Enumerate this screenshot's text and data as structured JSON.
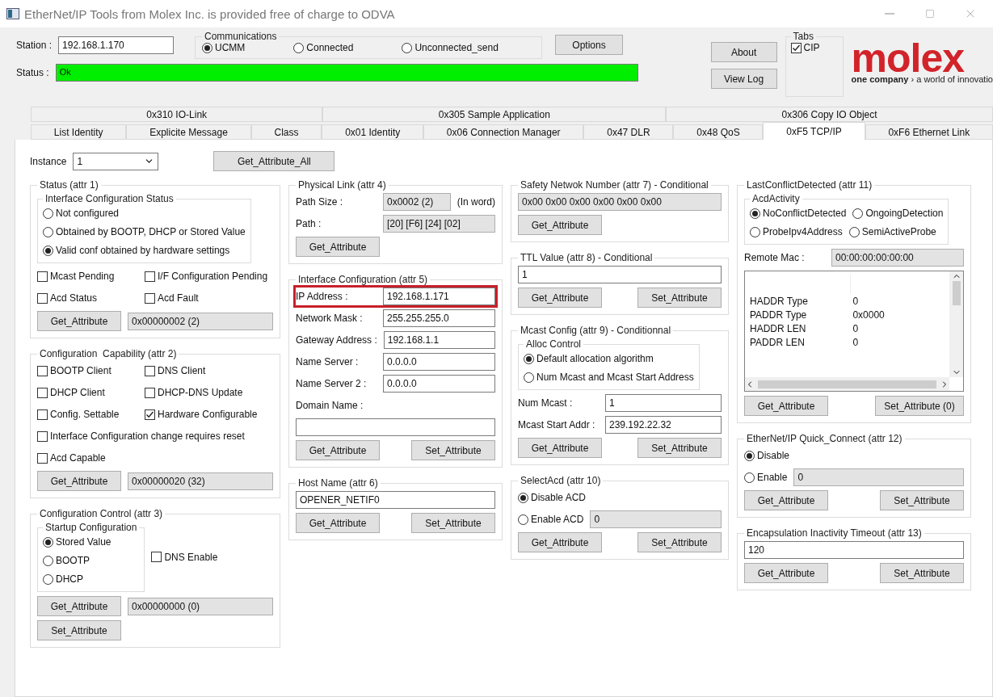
{
  "window": {
    "title": "EtherNet/IP Tools from Molex Inc. is provided free of charge to ODVA"
  },
  "header": {
    "station_label": "Station :",
    "station_value": "192.168.1.170",
    "communications": {
      "title": "Communications",
      "options": [
        {
          "label": "UCMM",
          "selected": true
        },
        {
          "label": "Connected",
          "selected": false
        },
        {
          "label": "Unconnected_send",
          "selected": false
        }
      ]
    },
    "options_button": "Options",
    "about_button": "About",
    "view_log_button": "View Log",
    "tabs_group": {
      "title": "Tabs",
      "options": [
        {
          "label": "CIP",
          "checked": true
        }
      ]
    },
    "logo": {
      "wordmark": "molex",
      "tagline": "**one company** › a world of innovatio"
    },
    "status": {
      "label": "Status :",
      "value": "Ok",
      "ok": true
    }
  },
  "tab_rows": [
    [
      {
        "label": "0x310 IO-Link",
        "selected": false
      },
      {
        "label": "0x305 Sample Application",
        "selected": false
      },
      {
        "label": "0x306 Copy IO Object",
        "selected": false
      }
    ],
    [
      {
        "label": "List Identity",
        "selected": false
      },
      {
        "label": "Explicite Message",
        "selected": false
      },
      {
        "label": "Class",
        "selected": false
      },
      {
        "label": "0x01 Identity",
        "selected": false
      },
      {
        "label": "0x06 Connection Manager",
        "selected": false
      },
      {
        "label": "0x47 DLR",
        "selected": false
      },
      {
        "label": "0x48 QoS",
        "selected": false
      },
      {
        "label": "0xF5 TCP/IP",
        "selected": true
      },
      {
        "label": "0xF6 Ethernet Link",
        "selected": false
      }
    ]
  ],
  "tab_page": {
    "instance": {
      "label": "Instance",
      "value": "1"
    },
    "get_all_button": "Get_Attribute_All",
    "columns": [
      [
        {
          "title": "Status (attr 1)",
          "rows": [
            [
              {
                "kind": "subgroup",
                "title": "Interface Configuration Status",
                "rows": [
                  [
                    {
                      "kind": "radio",
                      "label": "Not configured",
                      "selected": false
                    }
                  ],
                  [
                    {
                      "kind": "radio",
                      "label": "Obtained by BOOTP, DHCP or Stored Value",
                      "selected": false
                    }
                  ],
                  [
                    {
                      "kind": "radio",
                      "label": "Valid conf obtained by hardware settings",
                      "selected": true
                    }
                  ]
                ]
              }
            ],
            [
              {
                "kind": "checkbox",
                "label": "Mcast Pending",
                "checked": false
              },
              {
                "kind": "checkbox",
                "label": "I/F Configuration Pending",
                "checked": false
              }
            ],
            [
              {
                "kind": "checkbox",
                "label": "Acd Status",
                "checked": false
              },
              {
                "kind": "checkbox",
                "label": "Acd Fault",
                "checked": false
              }
            ],
            [
              {
                "kind": "button",
                "label": "Get_Attribute"
              },
              {
                "kind": "field",
                "value": "0x00000002 (2)",
                "readonly": true,
                "highlighted": false
              }
            ]
          ]
        },
        {
          "title": "Configuration  Capability (attr 2)",
          "rows": [
            [
              {
                "kind": "checkbox",
                "label": "BOOTP Client",
                "checked": false
              },
              {
                "kind": "checkbox",
                "label": "DNS Client",
                "checked": false
              }
            ],
            [
              {
                "kind": "checkbox",
                "label": "DHCP Client",
                "checked": false
              },
              {
                "kind": "checkbox",
                "label": "DHCP-DNS Update",
                "checked": false
              }
            ],
            [
              {
                "kind": "checkbox",
                "label": "Config. Settable",
                "checked": false
              },
              {
                "kind": "checkbox",
                "label": "Hardware Configurable",
                "checked": true
              }
            ],
            [
              {
                "kind": "checkbox",
                "label": "Interface Configuration change requires reset",
                "checked": false
              }
            ],
            [
              {
                "kind": "checkbox",
                "label": "Acd Capable",
                "checked": false
              }
            ],
            [
              {
                "kind": "button",
                "label": "Get_Attribute"
              },
              {
                "kind": "field",
                "value": "0x00000020 (32)",
                "readonly": true,
                "highlighted": false
              }
            ]
          ]
        },
        {
          "title": "Configuration Control (attr 3)",
          "rows": [
            [
              {
                "kind": "subgroup",
                "title": "Startup Configuration",
                "rows": [
                  [
                    {
                      "kind": "radio",
                      "label": "Stored Value",
                      "selected": true
                    }
                  ],
                  [
                    {
                      "kind": "radio",
                      "label": "BOOTP",
                      "selected": false
                    }
                  ],
                  [
                    {
                      "kind": "radio",
                      "label": "DHCP",
                      "selected": false
                    }
                  ]
                ]
              },
              {
                "kind": "checkbox",
                "label": "DNS Enable",
                "checked": false
              }
            ],
            [
              {
                "kind": "button",
                "label": "Get_Attribute"
              },
              {
                "kind": "field",
                "value": "0x00000000 (0)",
                "readonly": true,
                "highlighted": false
              }
            ],
            [
              {
                "kind": "button",
                "label": "Set_Attribute"
              }
            ]
          ]
        }
      ],
      [
        {
          "title": "Physical Link (attr 4)",
          "rows": [
            [
              {
                "kind": "field",
                "label": "Path Size :",
                "value": "0x0002 (2)",
                "readonly": true,
                "highlighted": false
              },
              {
                "kind": "text",
                "label": "(In word)"
              }
            ],
            [
              {
                "kind": "field",
                "label": "Path :",
                "value": "[20] [F6] [24] [02]",
                "readonly": true,
                "highlighted": false
              }
            ],
            [
              {
                "kind": "button",
                "label": "Get_Attribute"
              }
            ]
          ]
        },
        {
          "title": "Interface Configuration (attr 5)",
          "rows": [
            [
              {
                "kind": "field",
                "label": "IP Address :",
                "value": "192.168.1.171",
                "readonly": false,
                "highlighted": true
              }
            ],
            [
              {
                "kind": "field",
                "label": "Network Mask :",
                "value": "255.255.255.0",
                "readonly": false,
                "highlighted": false
              }
            ],
            [
              {
                "kind": "field",
                "label": "Gateway Address :",
                "value": "192.168.1.1",
                "readonly": false,
                "highlighted": false
              }
            ],
            [
              {
                "kind": "field",
                "label": "Name Server :",
                "value": "0.0.0.0",
                "readonly": false,
                "highlighted": false
              }
            ],
            [
              {
                "kind": "field",
                "label": "Name Server 2 :",
                "value": "0.0.0.0",
                "readonly": false,
                "highlighted": false
              }
            ],
            [
              {
                "kind": "text",
                "label": "Domain Name :"
              }
            ],
            [
              {
                "kind": "field",
                "readonly": false,
                "highlighted": false
              }
            ],
            [
              {
                "kind": "button",
                "label": "Get_Attribute"
              },
              {
                "kind": "button",
                "label": "Set_Attribute"
              }
            ]
          ]
        },
        {
          "title": "Host Name (attr 6)",
          "rows": [
            [
              {
                "kind": "field",
                "value": "OPENER_NETIF0",
                "readonly": false,
                "highlighted": false
              }
            ],
            [
              {
                "kind": "button",
                "label": "Get_Attribute"
              },
              {
                "kind": "button",
                "label": "Set_Attribute"
              }
            ]
          ]
        }
      ],
      [
        {
          "title": "Safety Netwok Number (attr 7) - Conditional",
          "rows": [
            [
              {
                "kind": "field",
                "value": "0x00 0x00 0x00 0x00 0x00 0x00",
                "readonly": true,
                "highlighted": false
              }
            ],
            [
              {
                "kind": "button",
                "label": "Get_Attribute"
              }
            ]
          ]
        },
        {
          "title": "TTL Value (attr 8) - Conditional",
          "rows": [
            [
              {
                "kind": "field",
                "value": "1",
                "readonly": false,
                "highlighted": false
              }
            ],
            [
              {
                "kind": "button",
                "label": "Get_Attribute"
              },
              {
                "kind": "button",
                "label": "Set_Attribute"
              }
            ]
          ]
        },
        {
          "title": "Mcast Config (attr 9) - Conditionnal",
          "rows": [
            [
              {
                "kind": "subgroup",
                "title": "Alloc Control",
                "rows": [
                  [
                    {
                      "kind": "radio",
                      "label": "Default allocation algorithm",
                      "selected": true
                    }
                  ],
                  [
                    {
                      "kind": "radio",
                      "label": "Num Mcast and Mcast Start Address",
                      "selected": false
                    }
                  ]
                ]
              }
            ],
            [
              {
                "kind": "field",
                "label": "Num Mcast :",
                "value": "1",
                "readonly": false,
                "highlighted": false
              }
            ],
            [
              {
                "kind": "field",
                "label": "Mcast Start Addr :",
                "value": "239.192.22.32",
                "readonly": false,
                "highlighted": false
              }
            ],
            [
              {
                "kind": "button",
                "label": "Get_Attribute"
              },
              {
                "kind": "button",
                "label": "Set_Attribute"
              }
            ]
          ]
        },
        {
          "title": "SelectAcd (attr 10)",
          "rows": [
            [
              {
                "kind": "radio",
                "label": "Disable ACD",
                "selected": true
              }
            ],
            [
              {
                "kind": "radio",
                "label": "Enable ACD",
                "selected": false
              },
              {
                "kind": "field",
                "value": "0",
                "readonly": true,
                "highlighted": false
              }
            ],
            [
              {
                "kind": "button",
                "label": "Get_Attribute"
              },
              {
                "kind": "button",
                "label": "Set_Attribute"
              }
            ]
          ]
        }
      ],
      [
        {
          "title": "LastConflictDetected (attr 11)",
          "rows": [
            [
              {
                "kind": "subgroup",
                "title": "AcdActivity",
                "rows": [
                  [
                    {
                      "kind": "radio",
                      "label": "NoConflictDetected",
                      "selected": true
                    },
                    {
                      "kind": "radio",
                      "label": "OngoingDetection",
                      "selected": false
                    }
                  ],
                  [
                    {
                      "kind": "radio",
                      "label": "ProbeIpv4Address",
                      "selected": false
                    },
                    {
                      "kind": "radio",
                      "label": "SemiActiveProbe",
                      "selected": false
                    }
                  ]
                ]
              }
            ],
            [
              {
                "kind": "field",
                "label": "Remote Mac :",
                "value": "00:00:00:00:00:00",
                "readonly": true,
                "highlighted": false
              }
            ],
            [
              {
                "kind": "list",
                "rows": [
                  {
                    "name": "HADDR Type",
                    "value": "0"
                  },
                  {
                    "name": "PADDR Type",
                    "value": "0x0000"
                  },
                  {
                    "name": "HADDR LEN",
                    "value": "0"
                  },
                  {
                    "name": "PADDR LEN",
                    "value": "0"
                  }
                ]
              }
            ],
            [
              {
                "kind": "button",
                "label": "Get_Attribute"
              },
              {
                "kind": "button",
                "label": "Set_Attribute (0)"
              }
            ]
          ]
        },
        {
          "title": "EtherNet/IP Quick_Connect (attr 12)",
          "rows": [
            [
              {
                "kind": "radio",
                "label": "Disable",
                "selected": true
              }
            ],
            [
              {
                "kind": "radio",
                "label": "Enable",
                "selected": false
              },
              {
                "kind": "field",
                "value": "0",
                "readonly": true,
                "highlighted": false
              }
            ],
            [
              {
                "kind": "button",
                "label": "Get_Attribute"
              },
              {
                "kind": "button",
                "label": "Set_Attribute"
              }
            ]
          ]
        },
        {
          "title": "Encapsulation Inactivity Timeout (attr 13)",
          "rows": [
            [
              {
                "kind": "field",
                "value": "120",
                "readonly": false,
                "highlighted": false
              }
            ],
            [
              {
                "kind": "button",
                "label": "Get_Attribute"
              },
              {
                "kind": "button",
                "label": "Set_Attribute"
              }
            ]
          ]
        }
      ]
    ]
  }
}
